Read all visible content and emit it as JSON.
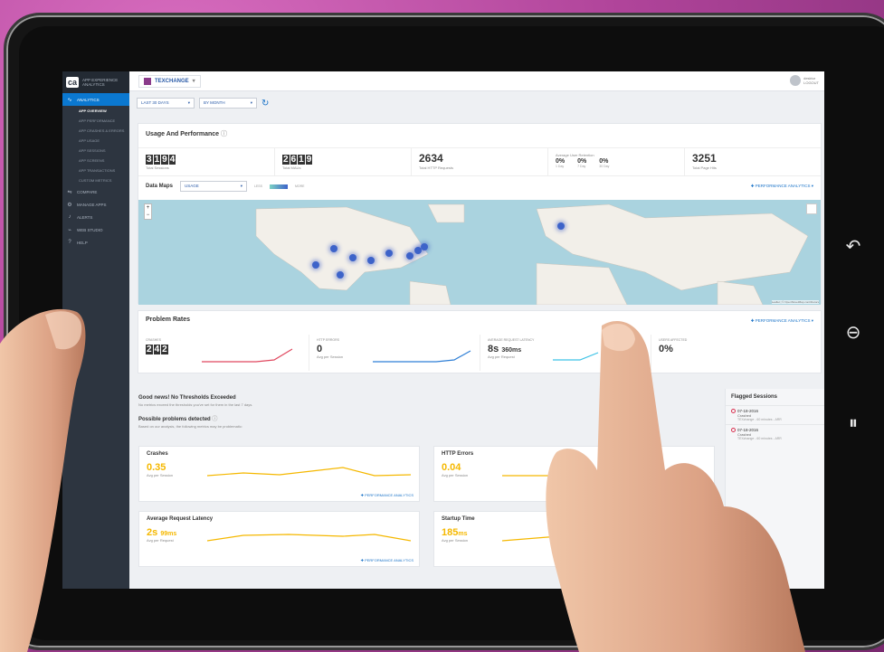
{
  "sidebar": {
    "logo_mark": "ca",
    "logo_text": "APP EXPERIENCE ANALYTICS",
    "items": [
      {
        "label": "ANALYTICS",
        "active": true,
        "icon": "analytics-icon"
      },
      {
        "label": "COMPARE",
        "icon": "compare-icon"
      },
      {
        "label": "MANAGE APPS",
        "icon": "gear-icon"
      },
      {
        "label": "ALERTS",
        "icon": "bell-icon"
      },
      {
        "label": "WEB STUDIO",
        "icon": "pulse-icon"
      },
      {
        "label": "HELP",
        "icon": "help-icon"
      }
    ],
    "subitems": [
      "APP OVERVIEW",
      "APP PERFORMANCE",
      "APP CRASHES & ERRORS",
      "APP USAGE",
      "APP SESSIONS",
      "APP SCREENS",
      "APP TRANSACTIONS",
      "CUSTOM METRICS"
    ]
  },
  "topbar": {
    "app_name": "TEXCHANGE",
    "user_name": "desktur",
    "user_action": "LOGOUT"
  },
  "filters": {
    "range": "LAST 30 DAYS",
    "group": "BY MONTH"
  },
  "usage": {
    "title": "Usage And Performance",
    "sessions_digits": [
      "3",
      "1",
      "9",
      "4"
    ],
    "sessions_label": "Total Sessions",
    "maus_digits": [
      "2",
      "6",
      "1",
      "9"
    ],
    "maus_label": "Total MAUs",
    "http": "2634",
    "http_label": "Total HTTP Requests",
    "retention_title": "Average User Retention",
    "retention": [
      {
        "v": "0%",
        "s": "1 Day"
      },
      {
        "v": "0%",
        "s": "7 Day"
      },
      {
        "v": "0%",
        "s": "30 Day"
      }
    ],
    "pagehits": "3251",
    "pagehits_label": "Total Page Hits"
  },
  "datamaps": {
    "title": "Data Maps",
    "select": "USAGE",
    "less": "LESS",
    "more": "MORE",
    "link": "PERFORMANCE ANALYTICS",
    "attribution": "Leaflet | © OpenStreetMap contributors"
  },
  "problems": {
    "title": "Problem Rates",
    "link": "PERFORMANCE ANALYTICS",
    "crashes_label": "CRASHES",
    "crashes_digits": [
      "2",
      "4",
      "2"
    ],
    "http_label": "HTTP ERRORS",
    "http_val": "0",
    "http_sub": "Avg per Session",
    "latency_label": "AVERAGE REQUEST LATENCY",
    "latency_s": "8s",
    "latency_ms": "360ms",
    "latency_sub": "Avg per Request",
    "users_label": "USERS AFFECTED",
    "users_val": "0%"
  },
  "thresholds": {
    "title": "Good news! No Thresholds Exceeded",
    "desc": "No metrics exceed the thresholds you've set for them in the last 7 days.",
    "possible_title": "Possible problems detected",
    "possible_desc": "Based on our analysis, the following metrics may be problematic:"
  },
  "minis": [
    {
      "title": "Crashes",
      "value": "0.35",
      "unit": "",
      "sub": "Avg per Session",
      "link": "PERFORMANCE ANALYTICS"
    },
    {
      "title": "HTTP Errors",
      "value": "0.04",
      "unit": "",
      "sub": "Avg per Session",
      "link": ""
    },
    {
      "title": "Average Request Latency",
      "value": "2s",
      "unit": "99ms",
      "sub": "Avg per Request",
      "link": "PERFORMANCE ANALYTICS"
    },
    {
      "title": "Startup Time",
      "value": "185",
      "unit": "ms",
      "sub": "Avg per Session",
      "link": ""
    }
  ],
  "flagged": {
    "title": "Flagged Sessions",
    "items": [
      {
        "date": "07-18-2016",
        "status": "Crashed",
        "meta": "TEXchange - 60 minutes - ARR"
      },
      {
        "date": "07-18-2016",
        "status": "Crashed",
        "meta": "TEXchange - 60 minutes - ARR"
      }
    ]
  },
  "colors": {
    "accent": "#0b78d0",
    "crash_line": "#e0485f",
    "http_line": "#2f7fd6",
    "latency_line": "#3cc2e6",
    "mini_line": "#f5b800"
  }
}
